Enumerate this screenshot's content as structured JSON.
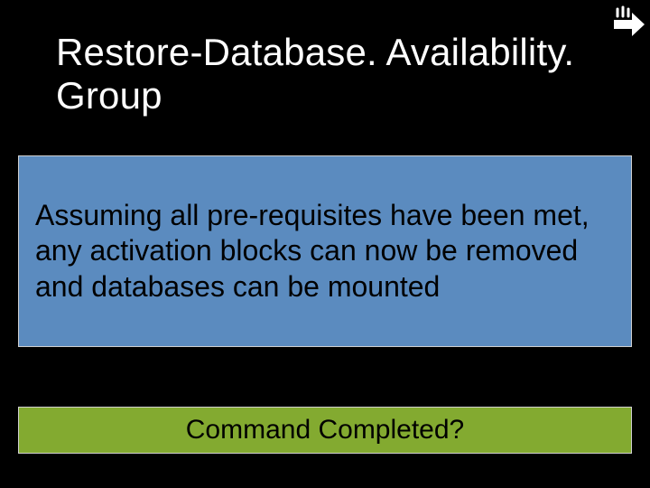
{
  "title": "Restore-Database. Availability. Group",
  "body": "Assuming all pre-requisites have been met, any activation blocks can now be removed and databases can be mounted",
  "footer": "Command Completed?",
  "colors": {
    "bg": "#000000",
    "band": "#5b8bbf",
    "footer": "#83aa30",
    "title_text": "#ffffff",
    "body_text": "#000000"
  }
}
